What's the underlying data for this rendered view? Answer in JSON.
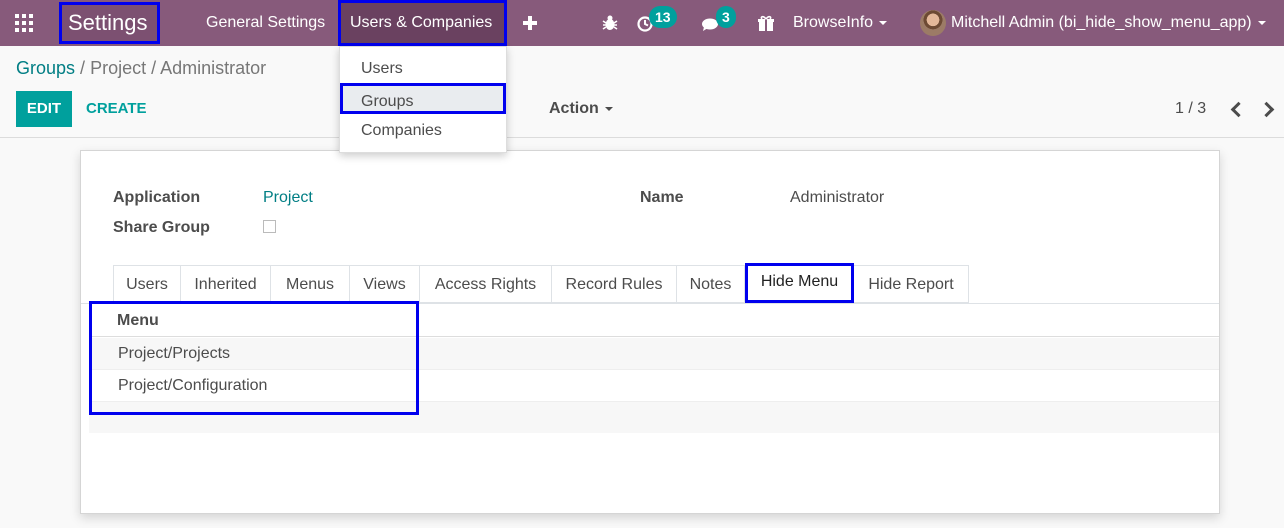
{
  "navbar": {
    "app_title": "Settings",
    "menu_general": "General Settings",
    "menu_users_companies": "Users & Companies",
    "activity_count": "13",
    "message_count": "3",
    "company": "BrowseInfo",
    "user": "Mitchell Admin (bi_hide_show_menu_app)"
  },
  "dropdown": {
    "items": [
      "Users",
      "Groups",
      "Companies"
    ],
    "highlighted": "Groups"
  },
  "breadcrumb": {
    "root": "Groups",
    "sep": "/",
    "current": "Project / Administrator"
  },
  "control_panel": {
    "edit_label": "EDIT",
    "create_label": "CREATE",
    "action_label": "Action",
    "pager": "1 / 3"
  },
  "form": {
    "application_label": "Application",
    "application_value": "Project",
    "name_label": "Name",
    "name_value": "Administrator",
    "share_group_label": "Share Group",
    "share_group_checked": false
  },
  "tabs": [
    "Users",
    "Inherited",
    "Menus",
    "Views",
    "Access Rights",
    "Record Rules",
    "Notes",
    "Hide Menu",
    "Hide Report"
  ],
  "active_tab": "Hide Menu",
  "menu_table": {
    "header": "Menu",
    "rows": [
      "Project/Projects",
      "Project/Configuration"
    ]
  },
  "colors": {
    "navbar": "#875a7b",
    "accent": "#00a09d",
    "link": "#017e84",
    "annotation": "#0000ee"
  }
}
